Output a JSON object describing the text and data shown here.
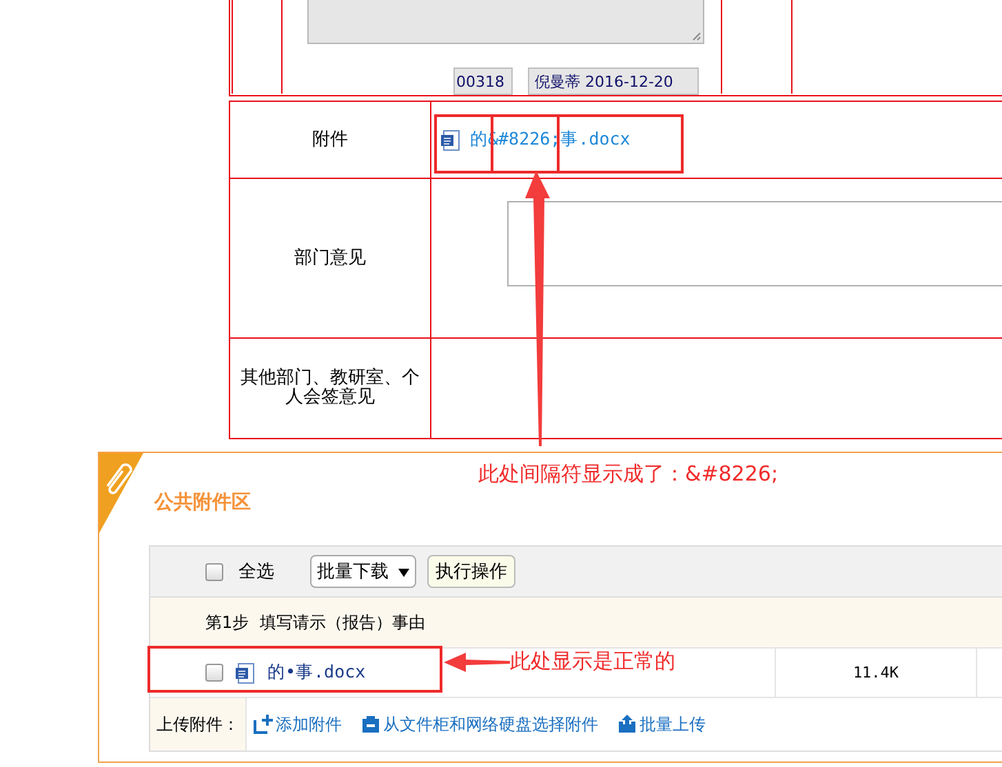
{
  "form": {
    "top_fields": [
      {
        "value": "00318"
      },
      {
        "value": "倪曼蒂 2016-12-20"
      }
    ],
    "rows": [
      {
        "kind": "attachment",
        "label": "附件",
        "file": "的&#8226;事.docx"
      },
      {
        "kind": "textarea",
        "label": "部门意见"
      },
      {
        "kind": "empty",
        "label": "其他部门、教研室、个人会签意见"
      }
    ]
  },
  "attachment_panel": {
    "title": "公共附件区",
    "toolbar": {
      "select_all": {
        "label": "全选",
        "checked": false
      },
      "batch_select": "批量下载",
      "execute_button": "执行操作"
    },
    "step": "第1步  填写请示（报告）事由",
    "files": [
      {
        "name": "的•事.docx",
        "size": "11.4K",
        "checked": false
      }
    ],
    "upload": {
      "label": "上传附件：",
      "actions": [
        {
          "kind": "add",
          "label": "添加附件"
        },
        {
          "kind": "cabinet",
          "label": "从文件柜和网络硬盘选择附件"
        },
        {
          "kind": "batch",
          "label": "批量上传"
        }
      ]
    }
  },
  "annotations": [
    {
      "text": "此处间隔符显示成了：&#8226;"
    },
    {
      "text": "此处显示是正常的"
    }
  ]
}
